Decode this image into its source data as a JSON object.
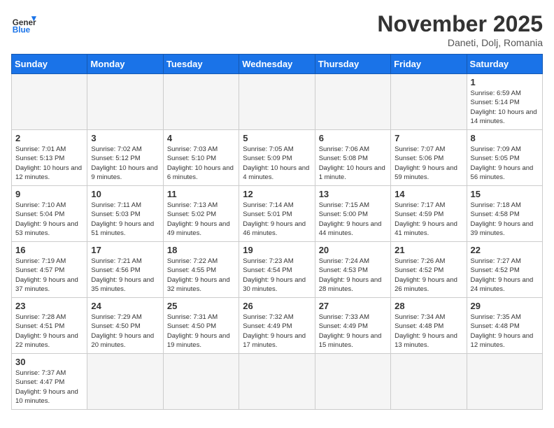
{
  "header": {
    "logo_general": "General",
    "logo_blue": "Blue",
    "month_title": "November 2025",
    "location": "Daneti, Dolj, Romania"
  },
  "weekdays": [
    "Sunday",
    "Monday",
    "Tuesday",
    "Wednesday",
    "Thursday",
    "Friday",
    "Saturday"
  ],
  "weeks": [
    [
      {
        "day": "",
        "info": ""
      },
      {
        "day": "",
        "info": ""
      },
      {
        "day": "",
        "info": ""
      },
      {
        "day": "",
        "info": ""
      },
      {
        "day": "",
        "info": ""
      },
      {
        "day": "",
        "info": ""
      },
      {
        "day": "1",
        "info": "Sunrise: 6:59 AM\nSunset: 5:14 PM\nDaylight: 10 hours and 14 minutes."
      }
    ],
    [
      {
        "day": "2",
        "info": "Sunrise: 7:01 AM\nSunset: 5:13 PM\nDaylight: 10 hours and 12 minutes."
      },
      {
        "day": "3",
        "info": "Sunrise: 7:02 AM\nSunset: 5:12 PM\nDaylight: 10 hours and 9 minutes."
      },
      {
        "day": "4",
        "info": "Sunrise: 7:03 AM\nSunset: 5:10 PM\nDaylight: 10 hours and 6 minutes."
      },
      {
        "day": "5",
        "info": "Sunrise: 7:05 AM\nSunset: 5:09 PM\nDaylight: 10 hours and 4 minutes."
      },
      {
        "day": "6",
        "info": "Sunrise: 7:06 AM\nSunset: 5:08 PM\nDaylight: 10 hours and 1 minute."
      },
      {
        "day": "7",
        "info": "Sunrise: 7:07 AM\nSunset: 5:06 PM\nDaylight: 9 hours and 59 minutes."
      },
      {
        "day": "8",
        "info": "Sunrise: 7:09 AM\nSunset: 5:05 PM\nDaylight: 9 hours and 56 minutes."
      }
    ],
    [
      {
        "day": "9",
        "info": "Sunrise: 7:10 AM\nSunset: 5:04 PM\nDaylight: 9 hours and 53 minutes."
      },
      {
        "day": "10",
        "info": "Sunrise: 7:11 AM\nSunset: 5:03 PM\nDaylight: 9 hours and 51 minutes."
      },
      {
        "day": "11",
        "info": "Sunrise: 7:13 AM\nSunset: 5:02 PM\nDaylight: 9 hours and 49 minutes."
      },
      {
        "day": "12",
        "info": "Sunrise: 7:14 AM\nSunset: 5:01 PM\nDaylight: 9 hours and 46 minutes."
      },
      {
        "day": "13",
        "info": "Sunrise: 7:15 AM\nSunset: 5:00 PM\nDaylight: 9 hours and 44 minutes."
      },
      {
        "day": "14",
        "info": "Sunrise: 7:17 AM\nSunset: 4:59 PM\nDaylight: 9 hours and 41 minutes."
      },
      {
        "day": "15",
        "info": "Sunrise: 7:18 AM\nSunset: 4:58 PM\nDaylight: 9 hours and 39 minutes."
      }
    ],
    [
      {
        "day": "16",
        "info": "Sunrise: 7:19 AM\nSunset: 4:57 PM\nDaylight: 9 hours and 37 minutes."
      },
      {
        "day": "17",
        "info": "Sunrise: 7:21 AM\nSunset: 4:56 PM\nDaylight: 9 hours and 35 minutes."
      },
      {
        "day": "18",
        "info": "Sunrise: 7:22 AM\nSunset: 4:55 PM\nDaylight: 9 hours and 32 minutes."
      },
      {
        "day": "19",
        "info": "Sunrise: 7:23 AM\nSunset: 4:54 PM\nDaylight: 9 hours and 30 minutes."
      },
      {
        "day": "20",
        "info": "Sunrise: 7:24 AM\nSunset: 4:53 PM\nDaylight: 9 hours and 28 minutes."
      },
      {
        "day": "21",
        "info": "Sunrise: 7:26 AM\nSunset: 4:52 PM\nDaylight: 9 hours and 26 minutes."
      },
      {
        "day": "22",
        "info": "Sunrise: 7:27 AM\nSunset: 4:52 PM\nDaylight: 9 hours and 24 minutes."
      }
    ],
    [
      {
        "day": "23",
        "info": "Sunrise: 7:28 AM\nSunset: 4:51 PM\nDaylight: 9 hours and 22 minutes."
      },
      {
        "day": "24",
        "info": "Sunrise: 7:29 AM\nSunset: 4:50 PM\nDaylight: 9 hours and 20 minutes."
      },
      {
        "day": "25",
        "info": "Sunrise: 7:31 AM\nSunset: 4:50 PM\nDaylight: 9 hours and 19 minutes."
      },
      {
        "day": "26",
        "info": "Sunrise: 7:32 AM\nSunset: 4:49 PM\nDaylight: 9 hours and 17 minutes."
      },
      {
        "day": "27",
        "info": "Sunrise: 7:33 AM\nSunset: 4:49 PM\nDaylight: 9 hours and 15 minutes."
      },
      {
        "day": "28",
        "info": "Sunrise: 7:34 AM\nSunset: 4:48 PM\nDaylight: 9 hours and 13 minutes."
      },
      {
        "day": "29",
        "info": "Sunrise: 7:35 AM\nSunset: 4:48 PM\nDaylight: 9 hours and 12 minutes."
      }
    ],
    [
      {
        "day": "30",
        "info": "Sunrise: 7:37 AM\nSunset: 4:47 PM\nDaylight: 9 hours and 10 minutes."
      },
      {
        "day": "",
        "info": ""
      },
      {
        "day": "",
        "info": ""
      },
      {
        "day": "",
        "info": ""
      },
      {
        "day": "",
        "info": ""
      },
      {
        "day": "",
        "info": ""
      },
      {
        "day": "",
        "info": ""
      }
    ]
  ]
}
